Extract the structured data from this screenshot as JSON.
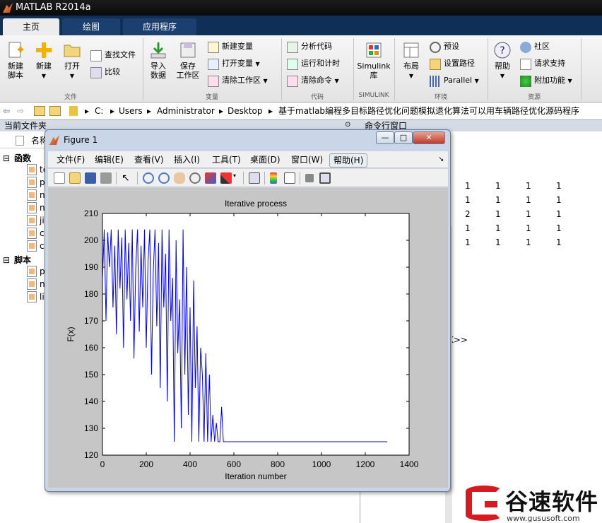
{
  "app_title": "MATLAB R2014a",
  "tabs": [
    "主页",
    "绘图",
    "应用程序"
  ],
  "ribbon": {
    "file": {
      "new_script": [
        "新建",
        "脚本"
      ],
      "new": "新建",
      "open": "打开",
      "find_files": "查找文件",
      "compare": "比较",
      "group_label": "文件"
    },
    "variable": {
      "import": [
        "导入",
        "数据"
      ],
      "save_ws": [
        "保存",
        "工作区"
      ],
      "new_var": "新建变量",
      "open_var": "打开变量",
      "clear_ws": "清除工作区",
      "group_label": "变量"
    },
    "code": {
      "analyze": "分析代码",
      "run_time": "运行和计时",
      "clear_cmd": "清除命令",
      "group_label": "代码"
    },
    "simulink": {
      "label": [
        "Simulink",
        "库"
      ],
      "group_label": "SIMULINK"
    },
    "env": {
      "layout": "布局",
      "prefs": "预设",
      "set_path": "设置路径",
      "parallel": "Parallel",
      "group_label": "环境"
    },
    "resources": {
      "help": "帮助",
      "community": "社区",
      "support": "请求支持",
      "addons": "附加功能",
      "group_label": "资源"
    }
  },
  "address": {
    "parts": [
      "C:",
      "Users",
      "Administrator",
      "Desktop",
      "基于matlab编程多目标路径优化问题模拟退化算法可以用车辆路径优化源码程序"
    ]
  },
  "left_panel": {
    "title": "当前文件夹",
    "col_name": "名称",
    "group_functions": "函数",
    "group_scripts": "脚本",
    "function_files": [
      "te",
      "p",
      "n",
      "n",
      "ji",
      "c",
      "c"
    ],
    "script_files": [
      "p",
      "n",
      "li"
    ]
  },
  "cmd_window": {
    "title": "命令行窗口",
    "rows": [
      [
        "1",
        "1",
        "1",
        "1"
      ],
      [
        "1",
        "1",
        "1",
        "1"
      ],
      [
        "2",
        "1",
        "1",
        "1"
      ],
      [
        "1",
        "1",
        "1",
        "1"
      ],
      [
        "1",
        "1",
        "1",
        "1"
      ]
    ],
    "prompt": "K>>"
  },
  "figure": {
    "title": "Figure 1",
    "menu": [
      "文件(F)",
      "编辑(E)",
      "查看(V)",
      "插入(I)",
      "工具(T)",
      "桌面(D)",
      "窗口(W)",
      "帮助(H)"
    ],
    "btn_min": "—",
    "btn_max": "□",
    "btn_close": "✕"
  },
  "chart_data": {
    "type": "line",
    "title": "Iterative process",
    "xlabel": "Iteration number",
    "ylabel": "F(x)",
    "xlim": [
      0,
      1400
    ],
    "ylim": [
      120,
      210
    ],
    "xticks": [
      0,
      200,
      400,
      600,
      800,
      1000,
      1200,
      1400
    ],
    "yticks": [
      120,
      130,
      140,
      150,
      160,
      170,
      180,
      190,
      200,
      210
    ],
    "grid": false,
    "series_color": "#0000ff",
    "series": [
      {
        "x": [
          0,
          8,
          16,
          24,
          32,
          40,
          48,
          56,
          64,
          72,
          80,
          88,
          96,
          104,
          112,
          120,
          128,
          136,
          144,
          152,
          160,
          168,
          176,
          184,
          192,
          200,
          208,
          216,
          224,
          232,
          240,
          248,
          256,
          264,
          272,
          280,
          288,
          296,
          304,
          312,
          320,
          328,
          336,
          344,
          352,
          360,
          368,
          376,
          384,
          392,
          400,
          408,
          416,
          424,
          432,
          440,
          448,
          456,
          464,
          472,
          480,
          488,
          496,
          504,
          512,
          520,
          528,
          536,
          544,
          552,
          560,
          1300
        ],
        "y": [
          185,
          204,
          170,
          203,
          190,
          204,
          175,
          198,
          165,
          204,
          182,
          201,
          160,
          204,
          178,
          199,
          170,
          204,
          156,
          190,
          204,
          166,
          198,
          175,
          204,
          160,
          192,
          204,
          150,
          188,
          204,
          168,
          199,
          145,
          204,
          175,
          195,
          140,
          204,
          170,
          186,
          125,
          200,
          158,
          178,
          130,
          204,
          150,
          190,
          135,
          175,
          125,
          185,
          145,
          168,
          125,
          160,
          150,
          125,
          158,
          125,
          150,
          125,
          135,
          125,
          132,
          125,
          125,
          138,
          125,
          125,
          125
        ]
      }
    ]
  },
  "watermark": {
    "text": "谷速软件",
    "url": "www.gususoft.com"
  }
}
